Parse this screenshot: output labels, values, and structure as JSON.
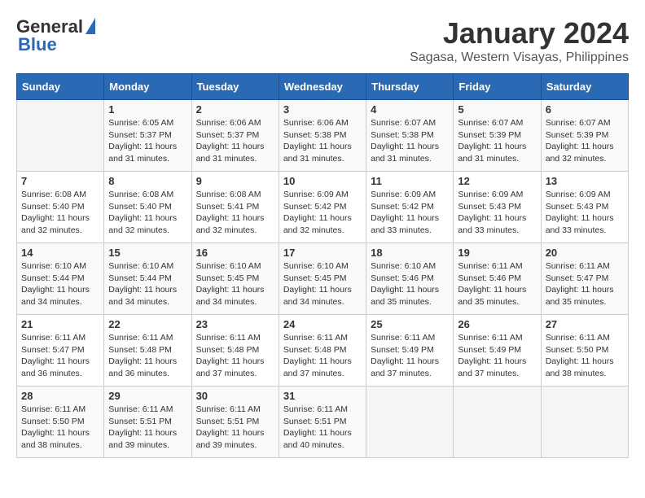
{
  "logo": {
    "general": "General",
    "blue": "Blue"
  },
  "title": "January 2024",
  "subtitle": "Sagasa, Western Visayas, Philippines",
  "days_of_week": [
    "Sunday",
    "Monday",
    "Tuesday",
    "Wednesday",
    "Thursday",
    "Friday",
    "Saturday"
  ],
  "weeks": [
    [
      {
        "day": "",
        "sunrise": "",
        "sunset": "",
        "daylight": ""
      },
      {
        "day": "1",
        "sunrise": "Sunrise: 6:05 AM",
        "sunset": "Sunset: 5:37 PM",
        "daylight": "Daylight: 11 hours and 31 minutes."
      },
      {
        "day": "2",
        "sunrise": "Sunrise: 6:06 AM",
        "sunset": "Sunset: 5:37 PM",
        "daylight": "Daylight: 11 hours and 31 minutes."
      },
      {
        "day": "3",
        "sunrise": "Sunrise: 6:06 AM",
        "sunset": "Sunset: 5:38 PM",
        "daylight": "Daylight: 11 hours and 31 minutes."
      },
      {
        "day": "4",
        "sunrise": "Sunrise: 6:07 AM",
        "sunset": "Sunset: 5:38 PM",
        "daylight": "Daylight: 11 hours and 31 minutes."
      },
      {
        "day": "5",
        "sunrise": "Sunrise: 6:07 AM",
        "sunset": "Sunset: 5:39 PM",
        "daylight": "Daylight: 11 hours and 31 minutes."
      },
      {
        "day": "6",
        "sunrise": "Sunrise: 6:07 AM",
        "sunset": "Sunset: 5:39 PM",
        "daylight": "Daylight: 11 hours and 32 minutes."
      }
    ],
    [
      {
        "day": "7",
        "sunrise": "Sunrise: 6:08 AM",
        "sunset": "Sunset: 5:40 PM",
        "daylight": "Daylight: 11 hours and 32 minutes."
      },
      {
        "day": "8",
        "sunrise": "Sunrise: 6:08 AM",
        "sunset": "Sunset: 5:40 PM",
        "daylight": "Daylight: 11 hours and 32 minutes."
      },
      {
        "day": "9",
        "sunrise": "Sunrise: 6:08 AM",
        "sunset": "Sunset: 5:41 PM",
        "daylight": "Daylight: 11 hours and 32 minutes."
      },
      {
        "day": "10",
        "sunrise": "Sunrise: 6:09 AM",
        "sunset": "Sunset: 5:42 PM",
        "daylight": "Daylight: 11 hours and 32 minutes."
      },
      {
        "day": "11",
        "sunrise": "Sunrise: 6:09 AM",
        "sunset": "Sunset: 5:42 PM",
        "daylight": "Daylight: 11 hours and 33 minutes."
      },
      {
        "day": "12",
        "sunrise": "Sunrise: 6:09 AM",
        "sunset": "Sunset: 5:43 PM",
        "daylight": "Daylight: 11 hours and 33 minutes."
      },
      {
        "day": "13",
        "sunrise": "Sunrise: 6:09 AM",
        "sunset": "Sunset: 5:43 PM",
        "daylight": "Daylight: 11 hours and 33 minutes."
      }
    ],
    [
      {
        "day": "14",
        "sunrise": "Sunrise: 6:10 AM",
        "sunset": "Sunset: 5:44 PM",
        "daylight": "Daylight: 11 hours and 34 minutes."
      },
      {
        "day": "15",
        "sunrise": "Sunrise: 6:10 AM",
        "sunset": "Sunset: 5:44 PM",
        "daylight": "Daylight: 11 hours and 34 minutes."
      },
      {
        "day": "16",
        "sunrise": "Sunrise: 6:10 AM",
        "sunset": "Sunset: 5:45 PM",
        "daylight": "Daylight: 11 hours and 34 minutes."
      },
      {
        "day": "17",
        "sunrise": "Sunrise: 6:10 AM",
        "sunset": "Sunset: 5:45 PM",
        "daylight": "Daylight: 11 hours and 34 minutes."
      },
      {
        "day": "18",
        "sunrise": "Sunrise: 6:10 AM",
        "sunset": "Sunset: 5:46 PM",
        "daylight": "Daylight: 11 hours and 35 minutes."
      },
      {
        "day": "19",
        "sunrise": "Sunrise: 6:11 AM",
        "sunset": "Sunset: 5:46 PM",
        "daylight": "Daylight: 11 hours and 35 minutes."
      },
      {
        "day": "20",
        "sunrise": "Sunrise: 6:11 AM",
        "sunset": "Sunset: 5:47 PM",
        "daylight": "Daylight: 11 hours and 35 minutes."
      }
    ],
    [
      {
        "day": "21",
        "sunrise": "Sunrise: 6:11 AM",
        "sunset": "Sunset: 5:47 PM",
        "daylight": "Daylight: 11 hours and 36 minutes."
      },
      {
        "day": "22",
        "sunrise": "Sunrise: 6:11 AM",
        "sunset": "Sunset: 5:48 PM",
        "daylight": "Daylight: 11 hours and 36 minutes."
      },
      {
        "day": "23",
        "sunrise": "Sunrise: 6:11 AM",
        "sunset": "Sunset: 5:48 PM",
        "daylight": "Daylight: 11 hours and 37 minutes."
      },
      {
        "day": "24",
        "sunrise": "Sunrise: 6:11 AM",
        "sunset": "Sunset: 5:48 PM",
        "daylight": "Daylight: 11 hours and 37 minutes."
      },
      {
        "day": "25",
        "sunrise": "Sunrise: 6:11 AM",
        "sunset": "Sunset: 5:49 PM",
        "daylight": "Daylight: 11 hours and 37 minutes."
      },
      {
        "day": "26",
        "sunrise": "Sunrise: 6:11 AM",
        "sunset": "Sunset: 5:49 PM",
        "daylight": "Daylight: 11 hours and 37 minutes."
      },
      {
        "day": "27",
        "sunrise": "Sunrise: 6:11 AM",
        "sunset": "Sunset: 5:50 PM",
        "daylight": "Daylight: 11 hours and 38 minutes."
      }
    ],
    [
      {
        "day": "28",
        "sunrise": "Sunrise: 6:11 AM",
        "sunset": "Sunset: 5:50 PM",
        "daylight": "Daylight: 11 hours and 38 minutes."
      },
      {
        "day": "29",
        "sunrise": "Sunrise: 6:11 AM",
        "sunset": "Sunset: 5:51 PM",
        "daylight": "Daylight: 11 hours and 39 minutes."
      },
      {
        "day": "30",
        "sunrise": "Sunrise: 6:11 AM",
        "sunset": "Sunset: 5:51 PM",
        "daylight": "Daylight: 11 hours and 39 minutes."
      },
      {
        "day": "31",
        "sunrise": "Sunrise: 6:11 AM",
        "sunset": "Sunset: 5:51 PM",
        "daylight": "Daylight: 11 hours and 40 minutes."
      },
      {
        "day": "",
        "sunrise": "",
        "sunset": "",
        "daylight": ""
      },
      {
        "day": "",
        "sunrise": "",
        "sunset": "",
        "daylight": ""
      },
      {
        "day": "",
        "sunrise": "",
        "sunset": "",
        "daylight": ""
      }
    ]
  ]
}
